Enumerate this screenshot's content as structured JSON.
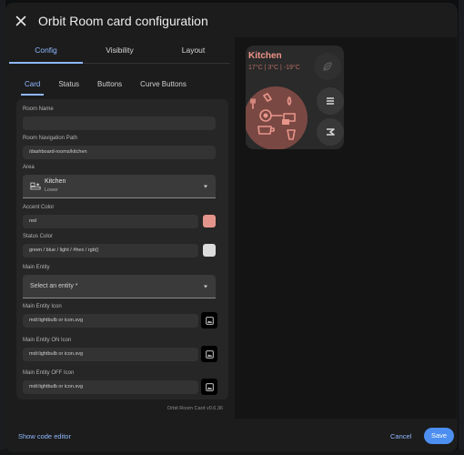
{
  "dialog": {
    "title": "Orbit Room card configuration"
  },
  "tabs": [
    {
      "label": "Config",
      "active": true
    },
    {
      "label": "Visibility",
      "active": false
    },
    {
      "label": "Layout",
      "active": false
    }
  ],
  "subtabs": [
    {
      "label": "Card",
      "active": true
    },
    {
      "label": "Status",
      "active": false
    },
    {
      "label": "Buttons",
      "active": false
    },
    {
      "label": "Curve Buttons",
      "active": false
    }
  ],
  "form": {
    "room_name": {
      "label": "Room Name",
      "value": ""
    },
    "nav_path": {
      "label": "Room Navigation Path",
      "value": "/dashboard-rooms/kitchen"
    },
    "area": {
      "label": "Area",
      "name": "Kitchen",
      "floor": "Lower",
      "icon": "home-sofa-icon"
    },
    "accent_color": {
      "label": "Accent Color",
      "value": "red",
      "swatch": "#e3958b"
    },
    "status_color": {
      "label": "Status Color",
      "placeholder": "green / blue / light / #hex / rgb()",
      "swatch": "#dcdcdc"
    },
    "main_entity": {
      "label": "Main Entity",
      "placeholder": "Select an entity *"
    },
    "main_entity_icon": {
      "label": "Main Entity Icon",
      "placeholder": "mdi:lightbulb or icon.svg"
    },
    "main_entity_on_icon": {
      "label": "Main Entity ON Icon",
      "placeholder": "mdi:lightbulb or icon.svg"
    },
    "main_entity_off_icon": {
      "label": "Main Entity OFF Icon",
      "placeholder": "mdi:lightbulb or icon.svg"
    },
    "version": "Orbit Room Card v0.6.36"
  },
  "preview": {
    "room_name": "Kitchen",
    "status": "17°C | 3°C | -19°C",
    "accent": "#f0958a",
    "buttons": [
      "leaf-icon",
      "radiator-icon",
      "shade-icon",
      "air-conditioner-icon"
    ]
  },
  "footer": {
    "show_code_editor": "Show code editor",
    "cancel": "Cancel",
    "save": "Save"
  },
  "colors": {
    "primary": "#8fb8ff",
    "save_bg": "#4d8ff0",
    "dialog_bg": "#1c1c1c"
  }
}
